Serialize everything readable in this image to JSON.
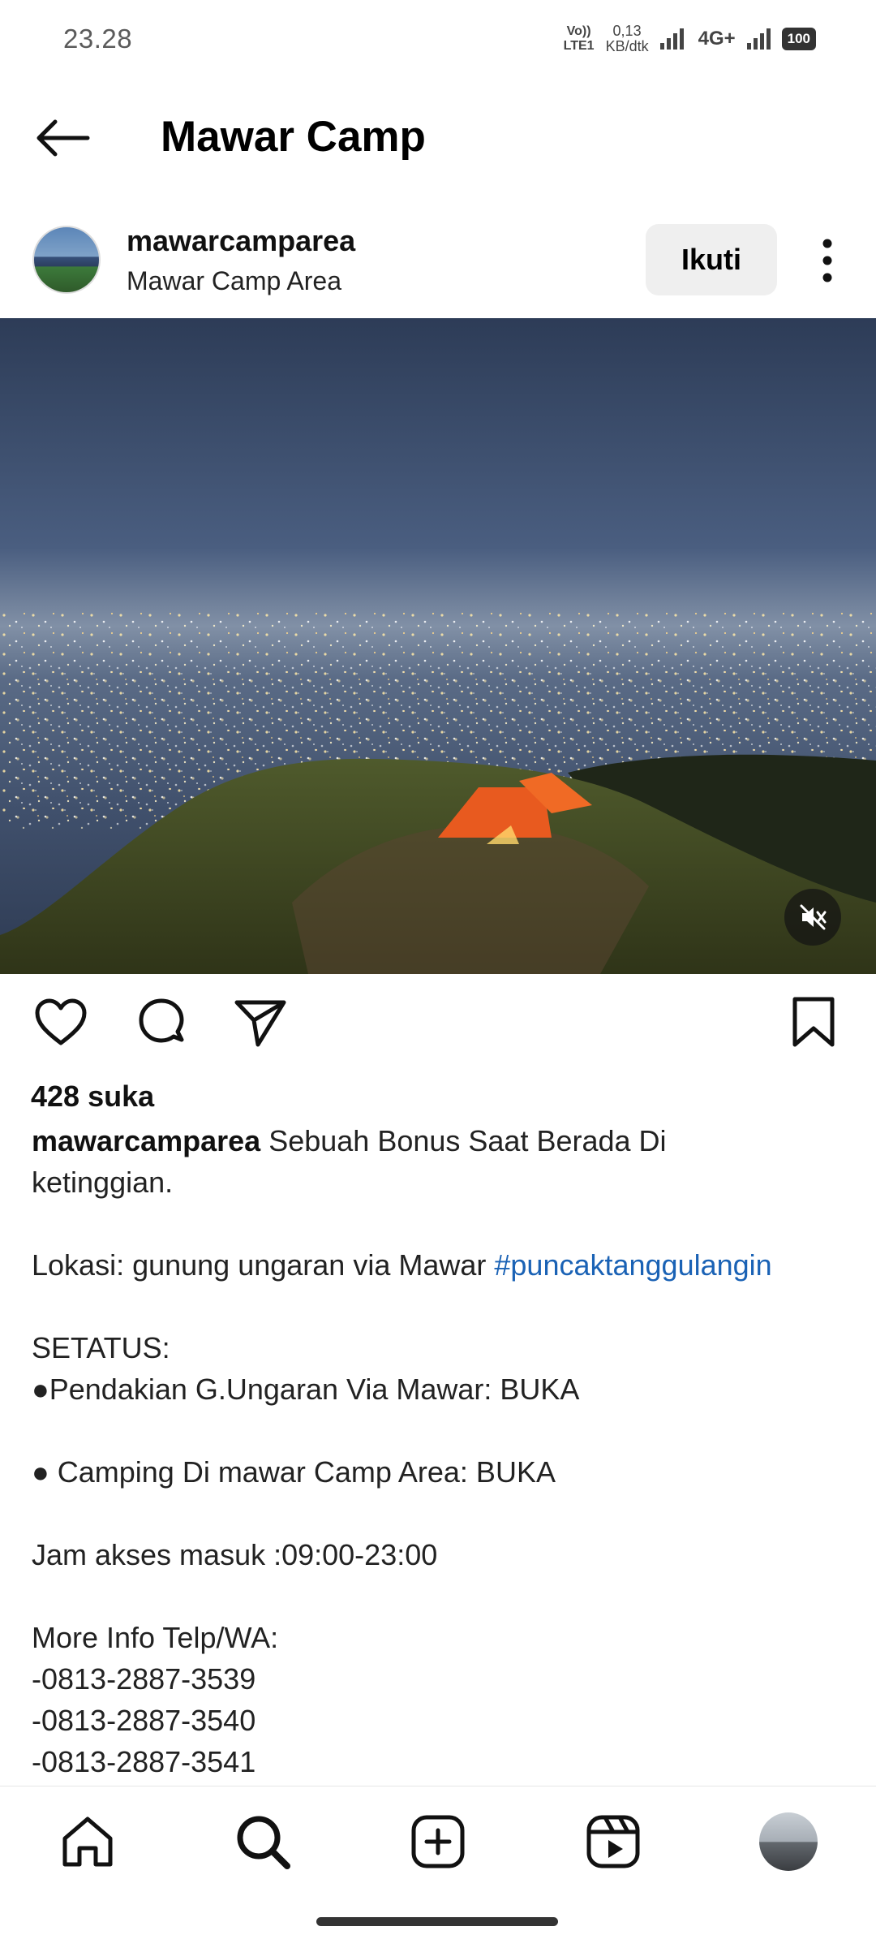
{
  "status_bar": {
    "time": "23.28",
    "volte_top": "Vo))",
    "volte_bottom": "LTE1",
    "speed_value": "0,13",
    "speed_unit": "KB/dtk",
    "network": "4G+",
    "battery": "100"
  },
  "header": {
    "title": "Mawar Camp"
  },
  "post": {
    "username": "mawarcamparea",
    "location": "Mawar Camp Area",
    "follow_label": "Ikuti",
    "likes": "428 suka",
    "caption": {
      "user": "mawarcamparea",
      "line1_rest": "Sebuah  Bonus  Saat Berada Di",
      "line2": "ketinggian.",
      "lokasi_text": "Lokasi: gunung ungaran via Mawar",
      "hashtag": "#puncaktanggulangin",
      "status_title": "SETATUS:",
      "pendakian": "●Pendakian G.Ungaran Via Mawar: BUKA",
      "camping": "● Camping  Di mawar Camp Area: BUKA",
      "jam": "Jam akses masuk :09:00-23:00",
      "info": "More Info  Telp/WA:",
      "phones": [
        "-0813-2887-3539",
        "-0813-2887-3540",
        "-0813-2887-3541"
      ]
    }
  },
  "icons": {
    "back": "arrow-left-icon",
    "more": "more-vertical-icon",
    "mute": "volume-muted-icon",
    "like": "heart-icon",
    "comment": "comment-icon",
    "share": "send-icon",
    "save": "bookmark-icon",
    "home": "home-icon",
    "search": "search-icon",
    "create": "plus-square-icon",
    "reels": "reels-icon"
  },
  "colors": {
    "hashtag": "#1a62b5",
    "tent": "#e85a1f",
    "follow_bg": "#efefef"
  }
}
